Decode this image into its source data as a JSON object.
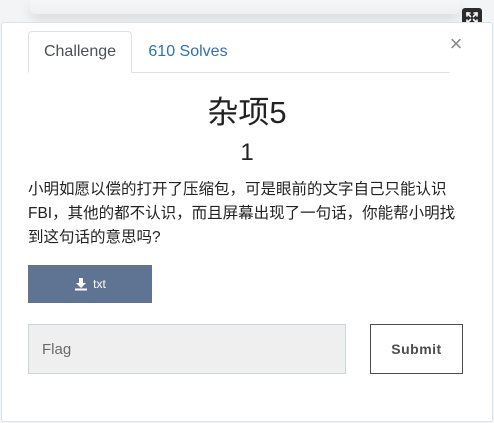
{
  "tabs": {
    "challenge_label": "Challenge",
    "solves_label": "610 Solves"
  },
  "modal": {
    "close_glyph": "×",
    "expand_icon": "expand-arrows-icon"
  },
  "challenge": {
    "name": "杂项5",
    "points": "1",
    "description": "小明如愿以偿的打开了压缩包，可是眼前的文字自己只能认识FBI，其他的都不认识，而且屏幕出现了一句话，你能帮小明找到这句话的意思吗?"
  },
  "file": {
    "label": "txt",
    "icon": "download-icon"
  },
  "form": {
    "flag_placeholder": "Flag",
    "flag_value": "",
    "submit_label": "Submit"
  },
  "colors": {
    "accent_link": "#2f70b8",
    "file_button": "#5f7492",
    "submit_border": "#4c4c4c"
  }
}
